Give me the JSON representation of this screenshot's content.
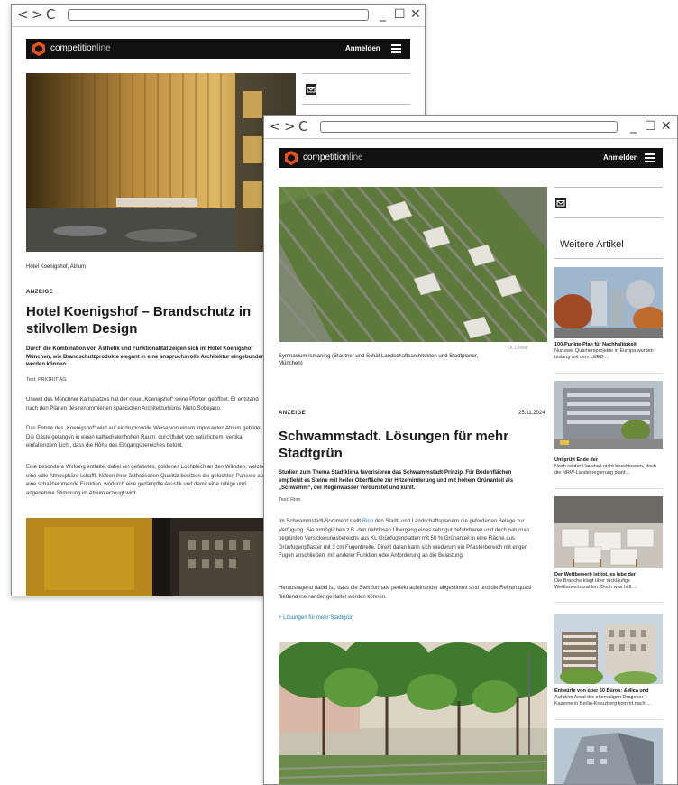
{
  "brand": {
    "name_strong": "competition",
    "name_light": "line",
    "login_label": "Anmelden"
  },
  "window_controls": {
    "back": "<",
    "forward": ">",
    "reload": "C",
    "minimize": "_",
    "maximize": "☐",
    "close": "✕"
  },
  "back_page": {
    "image_caption": "Hotel Koenigshof, Atrium",
    "kicker": "ANZEIGE",
    "headline": "Hotel Koenigshof – Brandschutz in stilvollem Design",
    "lead": "Durch die Kombination von Ästhetik und Funktionalität zeigen sich im Hotel Koenigshof München, wie Brandschutzprodukte elegant in eine anspruchsvolle Architektur eingebunden werden können.",
    "author": "Text: PRIORIT AG",
    "paragraphs": [
      "Unweit des Münchner Karlsplatzes hat der neue „Koenigshof“ seine Pforten geöffnet. Er entstand nach den Plänen des renommierten spanischen Architekturbüros Nieto Sobejano.",
      "Das Entree des „Koenigshof“ wird auf eindrucksvolle Weise von einem imposanten Atrium gebildet. Die Gäste gelangen in einen kathedralenhohen Raum, durchflutet von natürlichem, vertikal einfallendem Licht, dass die Höhe des Eingangsbereiches betont.",
      "Eine besondere Wirkung entfaltet dabei ein gefaltetes, goldenes Lochblech an den Wänden, welches eine edle Atmosphäre schafft. Neben ihrer ästhetischen Qualität besitzen die gelochten Paneele auch eine schallhemmende Funktion, wodurch eine gedämpfte Akustik und damit eine ruhige und angenehme Stimmung im Atrium erzeugt wird."
    ]
  },
  "front_page": {
    "image_caption": "Symnasium Ismaning (Stautner und Schäf Landschaftsarchitekten und Stadtplaner, München)",
    "image_credit": "Ol. Lowad",
    "kicker": "ANZEIGE",
    "date": "25.11.2024",
    "headline": "Schwammstadt. Lösungen für mehr Stadtgrün",
    "lead": "Studien zum Thema Stadtklima favorisieren das Schwammstadt-Prinzip. Für Bodenflächen empfiehlt es Steine mit heller Oberfläche zur Hitzeminderung und mit hohem Grünanteil als „Schwamm“, der Regenwasser verdunstet und kühlt.",
    "author": "Text: Rinn",
    "p1_before": "Im Schwammstadt-Sortiment stellt ",
    "p1_link": "Rinn",
    "p1_after": " den Stadt- und Landschaftsplanern die geforderten Beläge zur Verfügung. Sie ermöglichen z.B. den nahtlosen Übergang eines sehr gut befahrbaren und doch naturnah begrünten Versickerungsbereichs aus KL Grünfugenplatten mit 50 % Grünanteil in eine Fläche aus Grünfugenpflaster mit 3 cm Fugenbreite. Direkt daran kann sich wiederum ein Pflasterbereich mit engen Fugen anschließen, mit anderer Funktion oder Anforderung an die Belastung.",
    "p2": "Herausragend dabei ist, dass die Steinformate perfekt aufeinander abgestimmt sind und die Reihen quasi fließend ineinander gestaltet werden können.",
    "more_link": "+ Lösungen für mehr Stadtgrün",
    "sidebar_heading": "Weitere Artikel",
    "cards": [
      {
        "title": "100-Punkte-Plan für Nachhaltigkeit",
        "text": "Nur zwei Quartiersprojekte in Europa wurden bislang mit dem LEED ..."
      },
      {
        "title": "Uni prüft Ende der",
        "text": "Noch ist der Haushalt nicht beschlossen, doch die NRW-Landesregierung plant ..."
      },
      {
        "title": "Der Wettbewerb ist tot, es lebe der",
        "text": "Die Branche klagt über rückläufige Wettbewerbszahlen. Doch was hilft ..."
      },
      {
        "title": "Entwürfe von über 60 Büros: &Mica und",
        "text": "Auf dem Areal der ehemaligen Dragoner-Kaserne in Berlin-Kreuzberg kommt nach ..."
      }
    ]
  }
}
